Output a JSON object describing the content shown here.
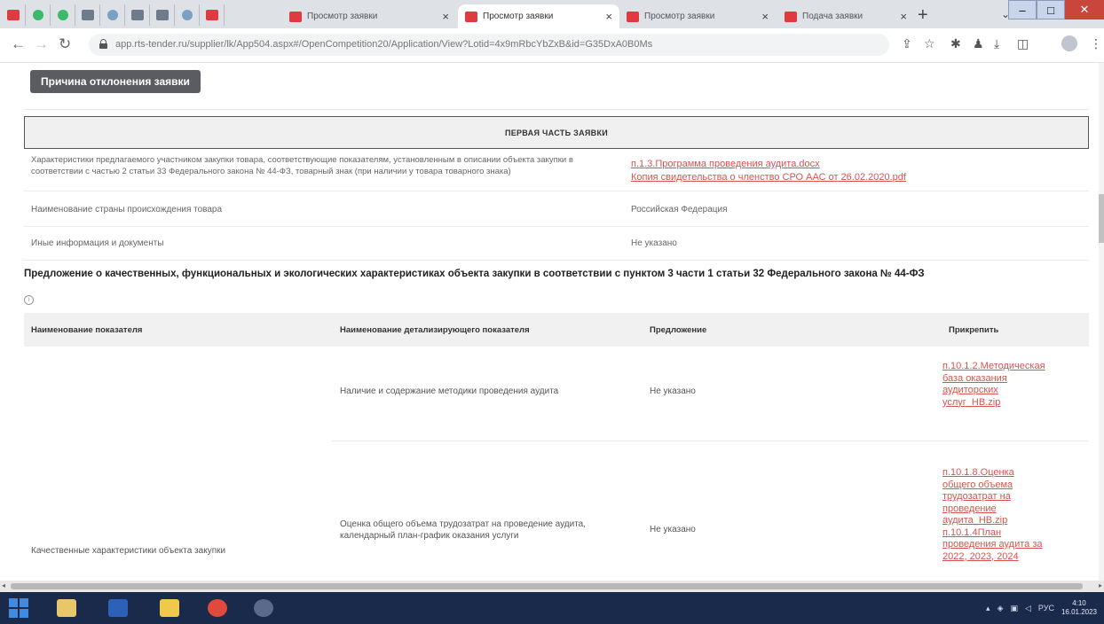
{
  "browser": {
    "tabs": [
      {
        "title": "Просмотр заявки",
        "active": false
      },
      {
        "title": "Просмотр заявки",
        "active": true
      },
      {
        "title": "Просмотр заявки",
        "active": false
      },
      {
        "title": "Подача заявки",
        "active": false
      }
    ],
    "new_tab_symbol": "+",
    "url": "app.rts-tender.ru/supplier/lk/App504.aspx#/OpenCompetition20/Application/View?Lotid=4x9mRbcYbZxB&id=G35DxA0B0Ms",
    "window_buttons": {
      "minimize": "–",
      "maximize": "□",
      "close": "✕"
    }
  },
  "page": {
    "reject_button": "Причина отклонения заявки",
    "section_header": "ПЕРВАЯ ЧАСТЬ ЗАЯВКИ",
    "first_part_rows": [
      {
        "label": "Характеристики предлагаемого участником закупки товара, соответствующие показателям, установленным в описании объекта закупки в соответствии с частью 2 статьи 33 Федерального закона № 44-ФЗ, товарный знак (при наличии у товара товарного знака)",
        "links": [
          "п.1.3.Программа проведения аудита.docx",
          "Копия свидетельства о членство СРО ААС от 26.02.2020.pdf"
        ]
      },
      {
        "label": "Наименование страны происхождения товара",
        "value": "Российская Федерация"
      },
      {
        "label": "Иные информация и документы",
        "value": "Не указано"
      }
    ],
    "proposal_title": "Предложение о качественных, функциональных и экологических характеристиках объекта закупки в соответствии с пунктом 3 части 1 статьи 32 Федерального закона № 44-ФЗ",
    "info_icon_char": "i",
    "table": {
      "headers": [
        "Наименование показателя",
        "Наименование детализирующего показателя",
        "Предложение",
        "Прикрепить"
      ],
      "indicator": "Качественные характеристики объекта закупки",
      "rows": [
        {
          "detail": "Наличие и содержание методики проведения аудита",
          "offer": "Не указано",
          "attachments": [
            "п.10.1.2.Методическая база оказания аудиторских услуг_НВ.zip"
          ]
        },
        {
          "detail": "Оценка общего объема трудозатрат на проведение аудита, календарный план-график оказания услуги",
          "offer": "Не указано",
          "attachments": [
            "п.10.1.8.Оценка общего объема трудозатрат на проведение аудита_НВ.zip",
            "п.10.1.4План проведения аудита за 2022, 2023, 2024"
          ]
        }
      ]
    }
  },
  "taskbar": {
    "apps": [
      "start-button",
      "file-explorer",
      "word",
      "folder",
      "chrome",
      "chrome-alt"
    ],
    "lang": "РУС",
    "time": "4:10",
    "date": "16.01.2023"
  },
  "colors": {
    "link": "#d9534f",
    "dark_button": "#5a5c61",
    "taskbar": "#1a2a4a"
  }
}
